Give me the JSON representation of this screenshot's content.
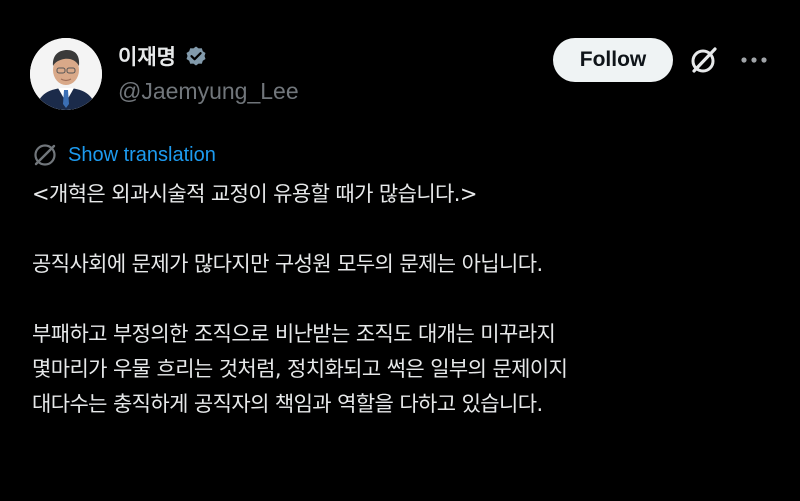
{
  "author": {
    "display_name": "이재명",
    "handle": "@Jaemyung_Lee",
    "verified": true,
    "avatar_icon": "profile-photo"
  },
  "actions": {
    "follow_label": "Follow",
    "grok_icon": "grok-icon",
    "more_icon": "more-icon"
  },
  "translation": {
    "label": "Show translation",
    "icon": "translate-globe-icon"
  },
  "tweet": {
    "paragraphs": [
      [
        "<개혁은 외과시술적 교정이 유용할 때가 많습니다.>"
      ],
      [
        "공직사회에 문제가 많다지만 구성원 모두의 문제는 아닙니다."
      ],
      [
        "부패하고 부정의한 조직으로 비난받는 조직도 대개는 미꾸라지",
        "몇마리가 우물 흐리는 것처럼, 정치화되고 썩은 일부의 문제이지",
        "대다수는 충직하게 공직자의 책임과 역할을 다하고 있습니다."
      ]
    ]
  },
  "colors": {
    "background": "#000000",
    "text_primary": "#e7e9ea",
    "text_secondary": "#71767b",
    "accent_link": "#1d9bf0",
    "follow_button_bg": "#eff3f4",
    "follow_button_text": "#0f1419",
    "verified_badge": "#829aab"
  }
}
